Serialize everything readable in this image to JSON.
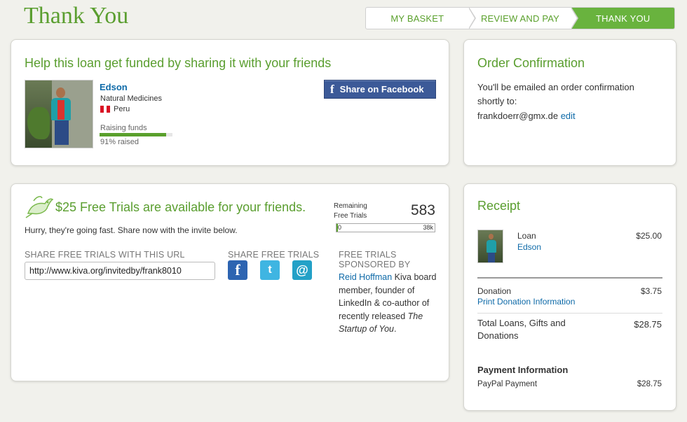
{
  "page_title": "Thank You",
  "steps": [
    {
      "label": "MY BASKET",
      "active": false
    },
    {
      "label": "REVIEW AND PAY",
      "active": false
    },
    {
      "label": "THANK YOU",
      "active": true
    }
  ],
  "share_card": {
    "heading": "Help this loan get funded by sharing it with your friends",
    "borrower_name": "Edson",
    "sector": "Natural Medicines",
    "country": "Peru",
    "status": "Raising funds",
    "progress_fraction": 0.91,
    "raised_text": "91% raised",
    "facebook_button": "Share on Facebook"
  },
  "confirmation": {
    "heading": "Order Confirmation",
    "text": "You'll be emailed an order confirmation shortly to:",
    "email": "frankdoerr@gmx.de",
    "edit_link": "edit"
  },
  "trials": {
    "heading": "$25 Free Trials are available for your friends.",
    "subtext": "Hurry, they're going fast. Share now with the invite below.",
    "remaining_label": "Remaining Free Trials",
    "remaining_count": "583",
    "bar_min": "0",
    "bar_max": "38k",
    "url_label": "SHARE FREE TRIALS WITH THIS URL",
    "url_value": "http://www.kiva.org/invitedby/frank8010",
    "share_label": "SHARE FREE TRIALS",
    "sponsor_label": "FREE TRIALS SPONSORED BY",
    "sponsor_name": "Reid Hoffman",
    "sponsor_text_1": " Kiva board member, founder of LinkedIn & co-author of recently released ",
    "sponsor_book": "The Startup of You",
    "sponsor_text_2": "."
  },
  "receipt": {
    "heading": "Receipt",
    "loan_label": "Loan",
    "loan_name": "Edson",
    "loan_amount": "$25.00",
    "donation_label": "Donation",
    "donation_link": "Print Donation Information",
    "donation_amount": "$3.75",
    "total_label": "Total Loans, Gifts and Donations",
    "total_amount": "$28.75",
    "payment_heading": "Payment Information",
    "payment_label": "PayPal Payment",
    "payment_amount": "$28.75"
  },
  "colors": {
    "accent_green": "#5a9e2f",
    "link_blue": "#0e6aa8",
    "facebook_blue": "#3c5a98"
  }
}
